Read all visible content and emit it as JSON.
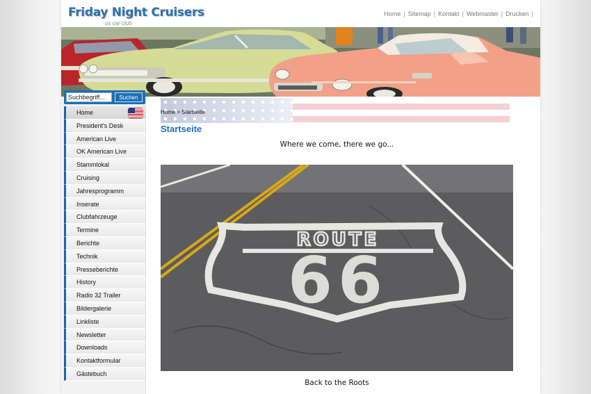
{
  "header": {
    "logo_title": "Friday Night Cruisers",
    "logo_subtitle": "us car club",
    "nav": [
      "Home",
      "Sitemap",
      "Kontakt",
      "Webmaster",
      "Drucken"
    ],
    "nav_separator": "|"
  },
  "search": {
    "value": "Suchbegriff...",
    "button_label": "Suchen"
  },
  "menu": {
    "items": [
      {
        "label": "Home",
        "active": true
      },
      {
        "label": "President's Desk"
      },
      {
        "label": "American Live"
      },
      {
        "label": "OK American Live"
      },
      {
        "label": "Stammlokal"
      },
      {
        "label": "Cruising"
      },
      {
        "label": "Jahresprogramm"
      },
      {
        "label": "Inserate"
      },
      {
        "label": "Clubfahrzeuge"
      },
      {
        "label": "Termine"
      },
      {
        "label": "Berichte"
      },
      {
        "label": "Technik"
      },
      {
        "label": "Presseberichte"
      },
      {
        "label": "History"
      },
      {
        "label": "Radio 32 Trailer"
      },
      {
        "label": "Bildergalerie"
      },
      {
        "label": "Linkliste"
      },
      {
        "label": "Newsletter"
      },
      {
        "label": "Downloads"
      },
      {
        "label": "Kontaktformular"
      },
      {
        "label": "Gästebuch"
      }
    ],
    "flag_icon": "us-flag-icon"
  },
  "content": {
    "breadcrumb": [
      "Home",
      "Startseite"
    ],
    "breadcrumb_separator": ">",
    "page_title": "Startseite",
    "tagline": "Where we come, there we go...",
    "image_text_top": "ROUTE",
    "image_text_number": "66",
    "caption": "Back to the Roots"
  },
  "colors": {
    "brand_blue": "#1f6fb5",
    "menu_accent": "#1a64a8",
    "search_bg": "#1d6fb3"
  }
}
